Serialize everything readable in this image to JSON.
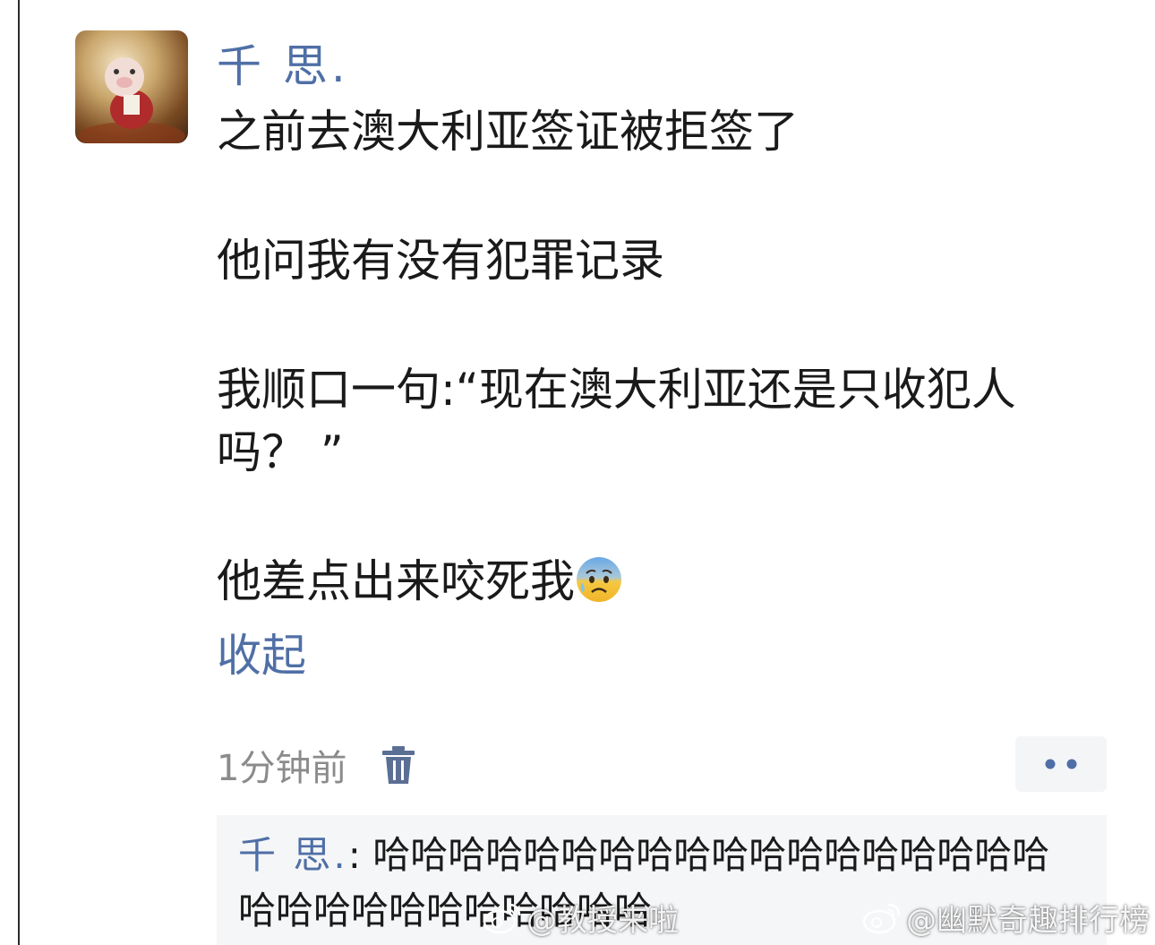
{
  "post": {
    "author": "千 思.",
    "paragraphs": [
      "之前去澳大利亚签证被拒签了",
      "他问我有没有犯罪记录",
      "我顺口一句:“现在澳大利亚还是只收犯人吗？ ”",
      "他差点出来咬死我"
    ],
    "emoji": "anxious-face-with-sweat",
    "collapse_label": "收起",
    "timestamp": "1分钟前"
  },
  "reply": {
    "author": "千 思.",
    "separator": ": ",
    "text": "哈哈哈哈哈哈哈哈哈哈哈哈哈哈哈哈哈哈哈哈哈哈哈哈哈哈哈哈哈"
  },
  "watermarks": [
    "@教授来啦",
    "@幽默奇趣排行榜"
  ],
  "colors": {
    "link_blue": "#4f6fa6",
    "timestamp_gray": "#8b8b8b",
    "reply_bg": "#f5f6f8"
  }
}
